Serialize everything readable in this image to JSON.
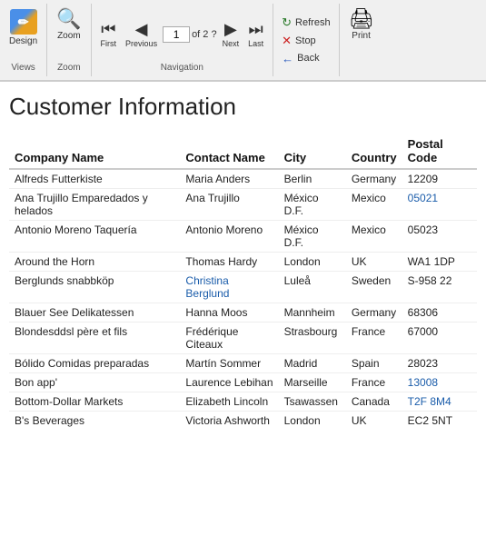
{
  "toolbar": {
    "design_label": "Design",
    "zoom_label": "Zoom",
    "first_label": "First",
    "previous_label": "Previous",
    "next_label": "Next",
    "last_label": "Last",
    "current_page": "1",
    "total_pages": "2",
    "refresh_label": "Refresh",
    "stop_label": "Stop",
    "back_label": "Back",
    "print_label": "Print",
    "groups": [
      "Views",
      "Zoom",
      "Navigation"
    ]
  },
  "report": {
    "title": "Customer Information",
    "columns": [
      "Company Name",
      "Contact Name",
      "City",
      "Country",
      "Postal Code"
    ],
    "rows": [
      {
        "company": "Alfreds Futterkiste",
        "contact": "Maria Anders",
        "city": "Berlin",
        "country": "Germany",
        "postal": "12209",
        "postal_blue": false,
        "contact_blue": false
      },
      {
        "company": "Ana Trujillo Emparedados y helados",
        "contact": "Ana Trujillo",
        "city": "México D.F.",
        "country": "Mexico",
        "postal": "05021",
        "postal_blue": true,
        "contact_blue": false
      },
      {
        "company": "Antonio Moreno Taquería",
        "contact": "Antonio Moreno",
        "city": "México D.F.",
        "country": "Mexico",
        "postal": "05023",
        "postal_blue": false,
        "contact_blue": false
      },
      {
        "company": "Around the Horn",
        "contact": "Thomas Hardy",
        "city": "London",
        "country": "UK",
        "postal": "WA1 1DP",
        "postal_blue": false,
        "contact_blue": false
      },
      {
        "company": "Berglunds snabbköp",
        "contact": "Christina Berglund",
        "city": "Luleå",
        "country": "Sweden",
        "postal": "S-958 22",
        "postal_blue": false,
        "contact_blue": true
      },
      {
        "company": "Blauer See Delikatessen",
        "contact": "Hanna Moos",
        "city": "Mannheim",
        "country": "Germany",
        "postal": "68306",
        "postal_blue": false,
        "contact_blue": false
      },
      {
        "company": "Blondesddsl père et fils",
        "contact": "Frédérique Citeaux",
        "city": "Strasbourg",
        "country": "France",
        "postal": "67000",
        "postal_blue": false,
        "contact_blue": false
      },
      {
        "company": "Bólido Comidas preparadas",
        "contact": "Martín Sommer",
        "city": "Madrid",
        "country": "Spain",
        "postal": "28023",
        "postal_blue": false,
        "contact_blue": false
      },
      {
        "company": "Bon app'",
        "contact": "Laurence Lebihan",
        "city": "Marseille",
        "country": "France",
        "postal": "13008",
        "postal_blue": true,
        "contact_blue": false
      },
      {
        "company": "Bottom-Dollar Markets",
        "contact": "Elizabeth Lincoln",
        "city": "Tsawassen",
        "country": "Canada",
        "postal": "T2F 8M4",
        "postal_blue": true,
        "contact_blue": false
      },
      {
        "company": "B's Beverages",
        "contact": "Victoria Ashworth",
        "city": "London",
        "country": "UK",
        "postal": "EC2 5NT",
        "postal_blue": false,
        "contact_blue": false
      }
    ]
  }
}
